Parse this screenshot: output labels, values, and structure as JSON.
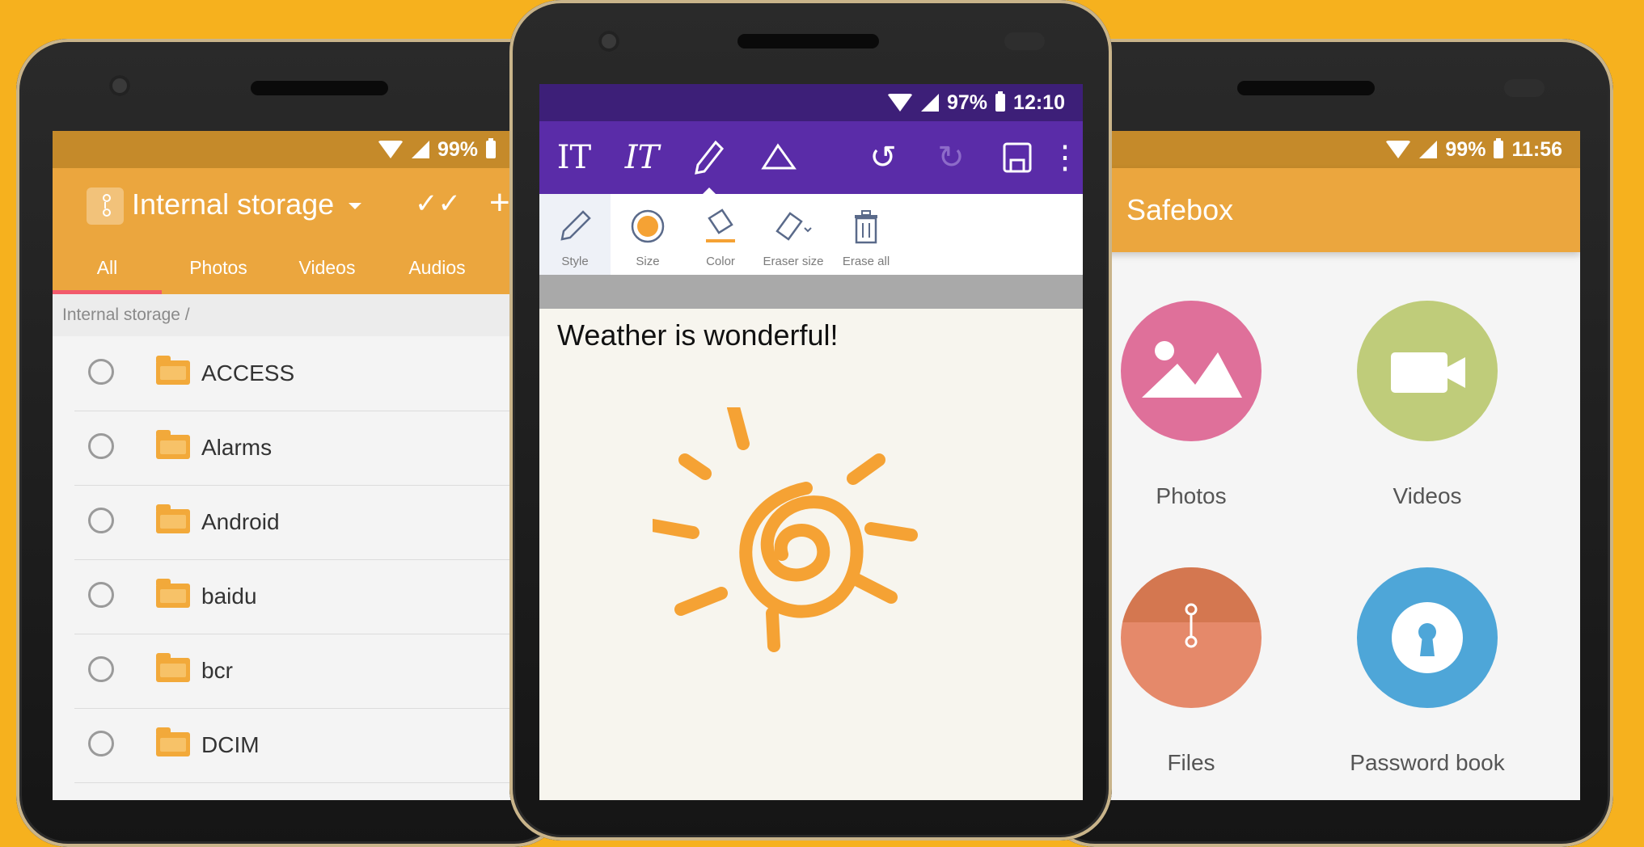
{
  "left_phone": {
    "status": {
      "battery": "99%"
    },
    "toolbar": {
      "title": "Internal storage"
    },
    "tabs": [
      {
        "label": "All",
        "active": true
      },
      {
        "label": "Photos"
      },
      {
        "label": "Videos"
      },
      {
        "label": "Audios"
      }
    ],
    "breadcrumb": "Internal storage /",
    "folders": [
      "ACCESS",
      "Alarms",
      "Android",
      "baidu",
      "bcr",
      "DCIM"
    ],
    "colors": {
      "toolbar": "#EBA63E",
      "status": "#C58A2A",
      "tab_indicator": "#F25A6B",
      "folder": "#F2A93A"
    }
  },
  "middle_phone": {
    "status": {
      "battery": "97%",
      "time": "12:10"
    },
    "toolbar_icons": [
      "text-icon",
      "handwriting-icon",
      "pencil-icon",
      "eraser-icon",
      "undo-icon",
      "redo-icon",
      "save-icon",
      "more-icon"
    ],
    "subtools": [
      {
        "label": "Style",
        "icon": "pen-style-icon"
      },
      {
        "label": "Size",
        "icon": "size-dot-icon"
      },
      {
        "label": "Color",
        "icon": "paint-bucket-icon"
      },
      {
        "label": "Eraser size",
        "icon": "eraser-size-icon"
      },
      {
        "label": "Erase all",
        "icon": "trash-icon"
      }
    ],
    "note_text": "Weather is wonderful!",
    "colors": {
      "toolbar": "#5A2CA8",
      "status": "#3D1F78",
      "accent": "#F5A234"
    }
  },
  "right_phone": {
    "status": {
      "battery": "99%",
      "time": "11:56"
    },
    "toolbar": {
      "title": "Safebox"
    },
    "tiles": [
      {
        "label": "Photos",
        "icon": "image-icon",
        "color": "#DF709A"
      },
      {
        "label": "Videos",
        "icon": "video-camera-icon",
        "color": "#BFCC7A"
      },
      {
        "label": "Files",
        "icon": "file-clip-icon",
        "color": "#E5896A"
      },
      {
        "label": "Password book",
        "icon": "keyhole-icon",
        "color": "#4EA6D8"
      }
    ]
  },
  "background_color": "#F6B11E"
}
